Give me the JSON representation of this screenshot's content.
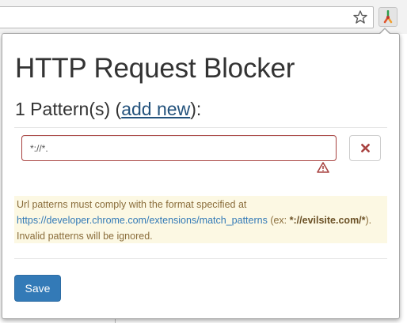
{
  "browser": {
    "star_icon": "star-icon",
    "extension_icon": "http-request-blocker-icon"
  },
  "popup": {
    "title": "HTTP Request Blocker",
    "heading": {
      "count_text": "1 Pattern(s) (",
      "add_link": "add new",
      "suffix": "):"
    },
    "patterns": [
      {
        "value": "*://*."
      }
    ],
    "info": {
      "text1": "Url patterns must comply with the format specified at ",
      "link": "https://developer.chrome.com/extensions/match_patterns",
      "text2": " (ex: ",
      "example": "*://evilsite.com/*",
      "text3": "). Invalid patterns will be ignored."
    },
    "save_label": "Save",
    "colors": {
      "primary": "#337ab7",
      "error": "#a94442",
      "warning_bg": "#fcf8e3",
      "warning_text": "#8a6d3b"
    }
  }
}
